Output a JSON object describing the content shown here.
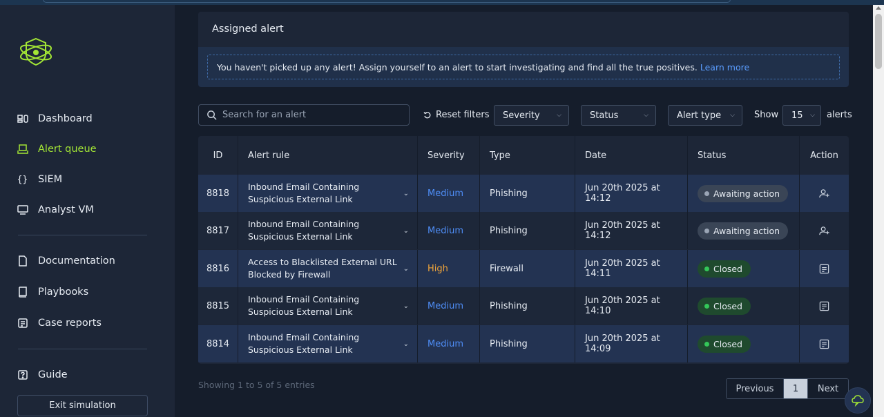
{
  "sidebar": {
    "logo_icon": "atom-shield-logo-icon",
    "items": [
      {
        "label": "Dashboard",
        "icon": "dashboard-icon",
        "active": false
      },
      {
        "label": "Alert queue",
        "icon": "inbox-icon",
        "active": true
      },
      {
        "label": "SIEM",
        "icon": "braces-icon",
        "active": false
      },
      {
        "label": "Analyst VM",
        "icon": "monitor-icon",
        "active": false
      },
      {
        "label": "Documentation",
        "icon": "document-icon",
        "active": false
      },
      {
        "label": "Playbooks",
        "icon": "book-icon",
        "active": false
      },
      {
        "label": "Case reports",
        "icon": "report-icon",
        "active": false
      },
      {
        "label": "Guide",
        "icon": "question-icon",
        "active": false
      }
    ],
    "exit_label": "Exit simulation"
  },
  "assigned": {
    "title": "Assigned alert",
    "notice": "You haven't picked up any alert! Assign yourself to an alert to start investigating and find all the true positives.",
    "link": "Learn more"
  },
  "filters": {
    "search_placeholder": "Search for an alert",
    "reset_label": "Reset filters",
    "severity_label": "Severity",
    "status_label": "Status",
    "type_label": "Alert type",
    "show_label": "Show",
    "page_size": "15",
    "alerts_label": "alerts"
  },
  "table": {
    "headers": [
      "ID",
      "Alert rule",
      "Severity",
      "Type",
      "Date",
      "Status",
      "Action"
    ],
    "rows": [
      {
        "id": "8818",
        "rule": "Inbound Email Containing Suspicious External Link",
        "severity": "Medium",
        "type": "Phishing",
        "date": "Jun 20th 2025 at 14:12",
        "status": "Awaiting action",
        "action_icon": "assign-user-icon"
      },
      {
        "id": "8817",
        "rule": "Inbound Email Containing Suspicious External Link",
        "severity": "Medium",
        "type": "Phishing",
        "date": "Jun 20th 2025 at 14:12",
        "status": "Awaiting action",
        "action_icon": "assign-user-icon"
      },
      {
        "id": "8816",
        "rule": "Access to Blacklisted External URL Blocked by Firewall",
        "severity": "High",
        "type": "Firewall",
        "date": "Jun 20th 2025 at 14:11",
        "status": "Closed",
        "action_icon": "report-icon"
      },
      {
        "id": "8815",
        "rule": "Inbound Email Containing Suspicious External Link",
        "severity": "Medium",
        "type": "Phishing",
        "date": "Jun 20th 2025 at 14:10",
        "status": "Closed",
        "action_icon": "report-icon"
      },
      {
        "id": "8814",
        "rule": "Inbound Email Containing Suspicious External Link",
        "severity": "Medium",
        "type": "Phishing",
        "date": "Jun 20th 2025 at 14:09",
        "status": "Closed",
        "action_icon": "report-icon"
      }
    ]
  },
  "footer": {
    "entries": "Showing 1 to 5 of 5 entries",
    "prev_label": "Previous",
    "page": "1",
    "next_label": "Next"
  },
  "colors": {
    "accent": "#a3e635",
    "medium": "#4f8ef7",
    "high": "#f0a53a",
    "closed": "#34c759"
  }
}
